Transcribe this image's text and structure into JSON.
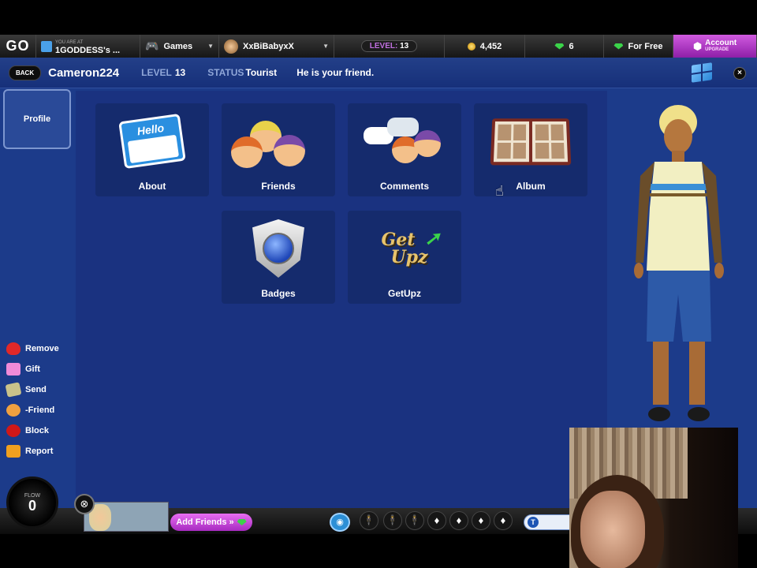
{
  "topbar": {
    "go": "GO",
    "location_small": "YOU ARE AT",
    "location": "1GODDESS's ...",
    "games": "Games",
    "username": "XxBiBabyxX",
    "level_word": "LEVEL:",
    "level_value": "13",
    "coins": "4,452",
    "gems": "6",
    "for_free": "For Free",
    "account": "Account",
    "account_sub": "UPGRADE",
    "colors": {
      "accent_purple": "#c23fd8",
      "gem_green": "#3bd34a",
      "coin_gold": "#e0a200"
    }
  },
  "profile": {
    "back": "BACK",
    "name": "Cameron224",
    "level_label": "LEVEL",
    "level": "13",
    "status_label": "STATUS",
    "status": "Tourist",
    "friend_text": "He is your friend.",
    "close": "×",
    "tab": "Profile"
  },
  "tiles": [
    {
      "label": "About",
      "icon": "hello-card-icon"
    },
    {
      "label": "Friends",
      "icon": "friends-faces-icon"
    },
    {
      "label": "Comments",
      "icon": "comments-bubbles-icon"
    },
    {
      "label": "Album",
      "icon": "photo-album-icon"
    },
    {
      "label": "Badges",
      "icon": "badge-shield-icon"
    },
    {
      "label": "GetUpz",
      "icon": "getupz-logo-icon"
    }
  ],
  "getupz_logo": {
    "line1": "Get",
    "line2": "Upz"
  },
  "hello_card": "Hello",
  "actions": [
    {
      "label": "Remove",
      "icon": "heart-icon",
      "color": "#e02828"
    },
    {
      "label": "Gift",
      "icon": "gift-icon",
      "color": "#f08ad8"
    },
    {
      "label": "Send",
      "icon": "money-icon",
      "color": "#c9c28a"
    },
    {
      "label": "-Friend",
      "icon": "unfriend-icon",
      "color": "#f0a040"
    },
    {
      "label": "Block",
      "icon": "block-icon",
      "color": "#d01818"
    },
    {
      "label": "Report",
      "icon": "report-icon",
      "color": "#f0a020"
    }
  ],
  "bottombar": {
    "flow_word": "FLOW",
    "flow_value": "0",
    "add_friends": "Add Friends »",
    "chat_icon": "T"
  }
}
